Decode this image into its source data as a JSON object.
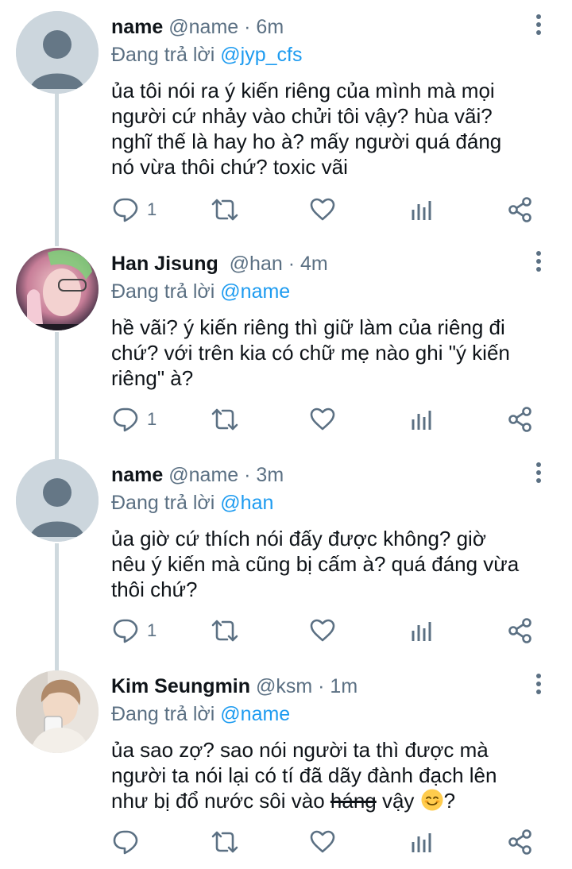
{
  "colors": {
    "text": "#0f1419",
    "secondary": "#5b7083",
    "link": "#1d9bf0",
    "thread_line": "#cfd9de",
    "default_avatar_bg": "#ccd6dd",
    "default_avatar_fg": "#657786"
  },
  "icons": {
    "reply": "speech-bubble-icon",
    "retweet": "retweet-icon",
    "like": "heart-icon",
    "stats": "bar-chart-icon",
    "share": "share-icon",
    "more": "vertical-dots-icon",
    "emoji": "smiling-face-emoji"
  },
  "tweets": [
    {
      "name": "name",
      "handle": "@name",
      "dot": "·",
      "time": "6m",
      "reply_prefix": "Đang trả lời",
      "reply_to": "@jyp_cfs",
      "text": "ủa tôi nói ra ý kiến riêng của mình mà mọi người cứ nhảy vào chửi tôi vậy? hùa vãi? nghĩ thế là hay ho à? mấy người quá đáng nó vừa thôi chứ? toxic vãi",
      "reply_count": "1",
      "avatar": "default-avatar"
    },
    {
      "name": "Han Jisung",
      "handle": "@han",
      "dot": "·",
      "time": "4m",
      "reply_prefix": "Đang trả lời",
      "reply_to": "@name",
      "text": "hề vãi? ý kiến riêng thì giữ làm của riêng đi chứ? với trên kia có chữ mẹ nào ghi \"ý kiến riêng\" à?",
      "reply_count": "1",
      "avatar": "photo-avatar"
    },
    {
      "name": "name",
      "handle": "@name",
      "dot": "·",
      "time": "3m",
      "reply_prefix": "Đang trả lời",
      "reply_to": "@han",
      "text": "ủa giờ cứ thích nói đấy được không? giờ nêu ý kiến mà cũng bị cấm à? quá đáng vừa thôi chứ?",
      "reply_count": "1",
      "avatar": "default-avatar"
    },
    {
      "name": "Kim Seungmin",
      "handle": "@ksm",
      "dot": "·",
      "time": "1m",
      "reply_prefix": "Đang trả lời",
      "reply_to": "@name",
      "text_before": "ủa sao zợ? sao nói người ta thì được mà người ta nói lại có tí đã dãy đành đạch lên như bị đổ nước sôi vào ",
      "text_struck": "háng",
      "text_after": " vậy",
      "text_end": "?",
      "reply_count": "",
      "avatar": "photo-avatar"
    }
  ]
}
